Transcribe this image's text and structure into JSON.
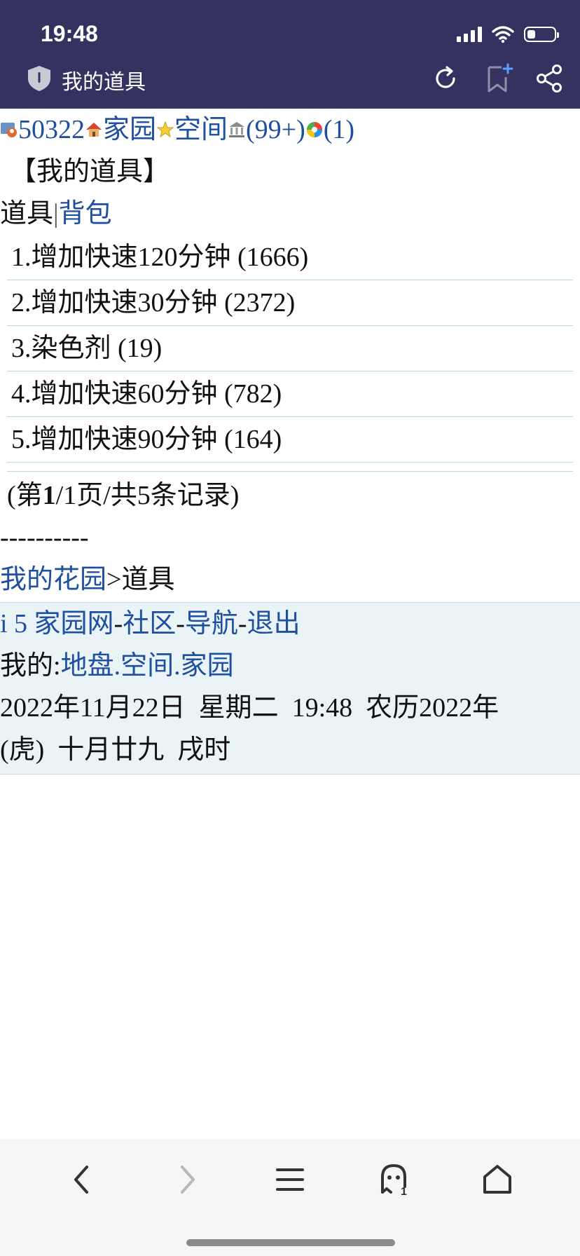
{
  "status_bar": {
    "time": "19:48",
    "battery_level": 0.3
  },
  "browser": {
    "page_title": "我的道具",
    "icons": [
      "shield-icon",
      "reload-icon",
      "add-bookmark-icon",
      "share-icon"
    ]
  },
  "header_links": {
    "uid": "50322",
    "home": "家园",
    "space": "空间",
    "messages": "(99+)",
    "notices": "(1)",
    "icons": [
      "user-icon",
      "house-icon",
      "star-icon",
      "bank-icon",
      "color-wheel-icon"
    ]
  },
  "page_heading": "【我的道具】",
  "tabs": {
    "current": "道具",
    "separator": "|",
    "backpack": "背包"
  },
  "items": [
    {
      "label": "1.增加快速120分钟 (1666)"
    },
    {
      "label": "2.增加快速30分钟 (2372)"
    },
    {
      "label": "3.染色剂 (19)"
    },
    {
      "label": "4.增加快速60分钟 (782)"
    },
    {
      "label": "5.增加快速90分钟 (164)"
    }
  ],
  "pagination": {
    "prefix": "(第",
    "page": "1",
    "suffix": "/1页/共5条记录)"
  },
  "divider": "----------",
  "breadcrumb": {
    "garden": "我的花园",
    "current": ">道具"
  },
  "footer": {
    "site": "i 5 家园网",
    "dash1": "-",
    "community": "社区",
    "dash2": "-",
    "navigation": "导航",
    "dash3": "-",
    "logout": "退出",
    "mine_label": "我的:",
    "land": "地盘",
    "dot1": ".",
    "space": "空间",
    "dot2": ".",
    "home": "家园",
    "datetime": "2022年11月22日  星期二  19:48  农历2022年(虎)  十月廿九  戌时"
  },
  "bottom_nav": {
    "icons": [
      "back-icon",
      "forward-icon",
      "menu-icon",
      "ghost-icon",
      "home-icon"
    ]
  }
}
